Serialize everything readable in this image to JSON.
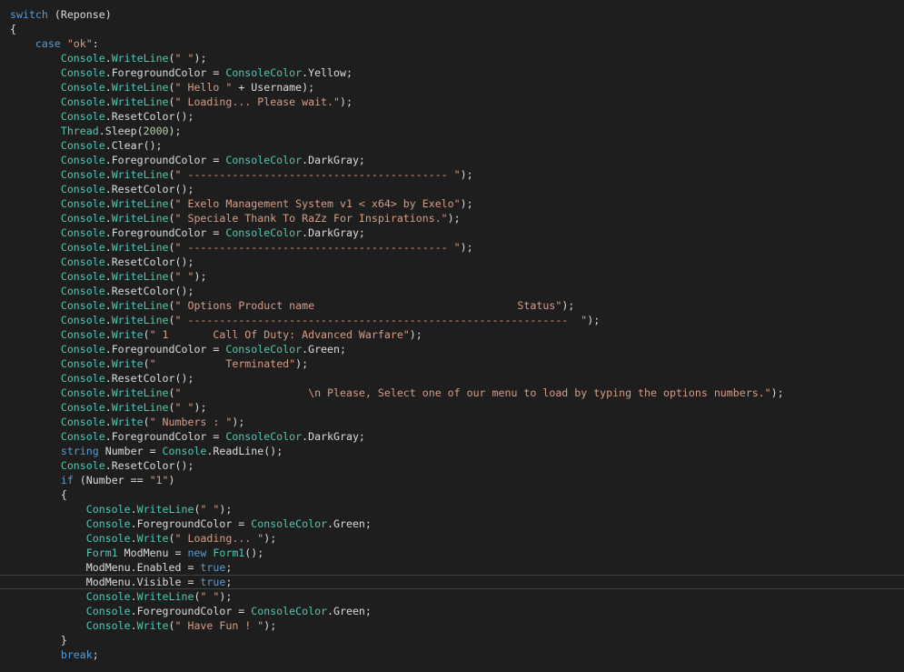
{
  "editor": {
    "language": "C#",
    "current_line_index": 39,
    "colors": {
      "background": "#1e1e1e",
      "plain": "#dcdcdc",
      "keyword": "#569cd6",
      "type": "#4ec9b0",
      "string": "#d69d85",
      "number": "#b5cea8"
    }
  },
  "lines": [
    [
      [
        "kw",
        "switch"
      ],
      [
        "pl",
        " (Reponse)"
      ]
    ],
    [
      [
        "pl",
        "{"
      ]
    ],
    [
      [
        "pl",
        "    "
      ],
      [
        "kw",
        "case"
      ],
      [
        "pl",
        " "
      ],
      [
        "str",
        "\"ok\""
      ],
      [
        "pl",
        ":"
      ]
    ],
    [
      [
        "pl",
        "        "
      ],
      [
        "ty",
        "Console"
      ],
      [
        "pl",
        "."
      ],
      [
        "ty",
        "WriteLine"
      ],
      [
        "pl",
        "("
      ],
      [
        "str",
        "\" \""
      ],
      [
        "pl",
        ");"
      ]
    ],
    [
      [
        "pl",
        "        "
      ],
      [
        "ty",
        "Console"
      ],
      [
        "pl",
        ".ForegroundColor = "
      ],
      [
        "ty",
        "ConsoleColor"
      ],
      [
        "pl",
        ".Yellow;"
      ]
    ],
    [
      [
        "pl",
        "        "
      ],
      [
        "ty",
        "Console"
      ],
      [
        "pl",
        "."
      ],
      [
        "ty",
        "WriteLine"
      ],
      [
        "pl",
        "("
      ],
      [
        "str",
        "\" Hello \""
      ],
      [
        "pl",
        " + Username);"
      ]
    ],
    [
      [
        "pl",
        "        "
      ],
      [
        "ty",
        "Console"
      ],
      [
        "pl",
        "."
      ],
      [
        "ty",
        "WriteLine"
      ],
      [
        "pl",
        "("
      ],
      [
        "str",
        "\" Loading... Please wait.\""
      ],
      [
        "pl",
        ");"
      ]
    ],
    [
      [
        "pl",
        "        "
      ],
      [
        "ty",
        "Console"
      ],
      [
        "pl",
        ".ResetColor();"
      ]
    ],
    [
      [
        "pl",
        "        "
      ],
      [
        "ty",
        "Thread"
      ],
      [
        "pl",
        ".Sleep("
      ],
      [
        "num",
        "2000"
      ],
      [
        "pl",
        ");"
      ]
    ],
    [
      [
        "pl",
        "        "
      ],
      [
        "ty",
        "Console"
      ],
      [
        "pl",
        ".Clear();"
      ]
    ],
    [
      [
        "pl",
        "        "
      ],
      [
        "ty",
        "Console"
      ],
      [
        "pl",
        ".ForegroundColor = "
      ],
      [
        "ty",
        "ConsoleColor"
      ],
      [
        "pl",
        ".DarkGray;"
      ]
    ],
    [
      [
        "pl",
        "        "
      ],
      [
        "ty",
        "Console"
      ],
      [
        "pl",
        "."
      ],
      [
        "ty",
        "WriteLine"
      ],
      [
        "pl",
        "("
      ],
      [
        "str",
        "\" ----------------------------------------- \""
      ],
      [
        "pl",
        ");"
      ]
    ],
    [
      [
        "pl",
        "        "
      ],
      [
        "ty",
        "Console"
      ],
      [
        "pl",
        ".ResetColor();"
      ]
    ],
    [
      [
        "pl",
        "        "
      ],
      [
        "ty",
        "Console"
      ],
      [
        "pl",
        "."
      ],
      [
        "ty",
        "WriteLine"
      ],
      [
        "pl",
        "("
      ],
      [
        "str",
        "\" Exelo Management System v1 < x64> by Exelo\""
      ],
      [
        "pl",
        ");"
      ]
    ],
    [
      [
        "pl",
        "        "
      ],
      [
        "ty",
        "Console"
      ],
      [
        "pl",
        "."
      ],
      [
        "ty",
        "WriteLine"
      ],
      [
        "pl",
        "("
      ],
      [
        "str",
        "\" Speciale Thank To RaZz For Inspirations.\""
      ],
      [
        "pl",
        ");"
      ]
    ],
    [
      [
        "pl",
        "        "
      ],
      [
        "ty",
        "Console"
      ],
      [
        "pl",
        ".ForegroundColor = "
      ],
      [
        "ty",
        "ConsoleColor"
      ],
      [
        "pl",
        ".DarkGray;"
      ]
    ],
    [
      [
        "pl",
        "        "
      ],
      [
        "ty",
        "Console"
      ],
      [
        "pl",
        "."
      ],
      [
        "ty",
        "WriteLine"
      ],
      [
        "pl",
        "("
      ],
      [
        "str",
        "\" ----------------------------------------- \""
      ],
      [
        "pl",
        ");"
      ]
    ],
    [
      [
        "pl",
        "        "
      ],
      [
        "ty",
        "Console"
      ],
      [
        "pl",
        ".ResetColor();"
      ]
    ],
    [
      [
        "pl",
        "        "
      ],
      [
        "ty",
        "Console"
      ],
      [
        "pl",
        "."
      ],
      [
        "ty",
        "WriteLine"
      ],
      [
        "pl",
        "("
      ],
      [
        "str",
        "\" \""
      ],
      [
        "pl",
        ");"
      ]
    ],
    [
      [
        "pl",
        "        "
      ],
      [
        "ty",
        "Console"
      ],
      [
        "pl",
        ".ResetColor();"
      ]
    ],
    [
      [
        "pl",
        "        "
      ],
      [
        "ty",
        "Console"
      ],
      [
        "pl",
        "."
      ],
      [
        "ty",
        "WriteLine"
      ],
      [
        "pl",
        "("
      ],
      [
        "str",
        "\" Options Product name                                Status\""
      ],
      [
        "pl",
        ");"
      ]
    ],
    [
      [
        "pl",
        "        "
      ],
      [
        "ty",
        "Console"
      ],
      [
        "pl",
        "."
      ],
      [
        "ty",
        "WriteLine"
      ],
      [
        "pl",
        "("
      ],
      [
        "str",
        "\" ------------------------------------------------------------  \""
      ],
      [
        "pl",
        ");"
      ]
    ],
    [
      [
        "pl",
        "        "
      ],
      [
        "ty",
        "Console"
      ],
      [
        "pl",
        "."
      ],
      [
        "ty",
        "Write"
      ],
      [
        "pl",
        "("
      ],
      [
        "str",
        "\" 1       Call Of Duty: Advanced Warfare\""
      ],
      [
        "pl",
        ");"
      ]
    ],
    [
      [
        "pl",
        "        "
      ],
      [
        "ty",
        "Console"
      ],
      [
        "pl",
        ".ForegroundColor = "
      ],
      [
        "ty",
        "ConsoleColor"
      ],
      [
        "pl",
        ".Green;"
      ]
    ],
    [
      [
        "pl",
        "        "
      ],
      [
        "ty",
        "Console"
      ],
      [
        "pl",
        "."
      ],
      [
        "ty",
        "Write"
      ],
      [
        "pl",
        "("
      ],
      [
        "str",
        "\"           Terminated\""
      ],
      [
        "pl",
        ");"
      ]
    ],
    [
      [
        "pl",
        "        "
      ],
      [
        "ty",
        "Console"
      ],
      [
        "pl",
        ".ResetColor();"
      ]
    ],
    [
      [
        "pl",
        "        "
      ],
      [
        "ty",
        "Console"
      ],
      [
        "pl",
        "."
      ],
      [
        "ty",
        "WriteLine"
      ],
      [
        "pl",
        "("
      ],
      [
        "str",
        "\"                    \\n Please, Select one of our menu to load by typing the options numbers.\""
      ],
      [
        "pl",
        ");"
      ]
    ],
    [
      [
        "pl",
        "        "
      ],
      [
        "ty",
        "Console"
      ],
      [
        "pl",
        "."
      ],
      [
        "ty",
        "WriteLine"
      ],
      [
        "pl",
        "("
      ],
      [
        "str",
        "\" \""
      ],
      [
        "pl",
        ");"
      ]
    ],
    [
      [
        "pl",
        "        "
      ],
      [
        "ty",
        "Console"
      ],
      [
        "pl",
        "."
      ],
      [
        "ty",
        "Write"
      ],
      [
        "pl",
        "("
      ],
      [
        "str",
        "\" Numbers : \""
      ],
      [
        "pl",
        ");"
      ]
    ],
    [
      [
        "pl",
        "        "
      ],
      [
        "ty",
        "Console"
      ],
      [
        "pl",
        ".ForegroundColor = "
      ],
      [
        "ty",
        "ConsoleColor"
      ],
      [
        "pl",
        ".DarkGray;"
      ]
    ],
    [
      [
        "pl",
        "        "
      ],
      [
        "kw",
        "string"
      ],
      [
        "pl",
        " Number = "
      ],
      [
        "ty",
        "Console"
      ],
      [
        "pl",
        ".ReadLine();"
      ]
    ],
    [
      [
        "pl",
        "        "
      ],
      [
        "ty",
        "Console"
      ],
      [
        "pl",
        ".ResetColor();"
      ]
    ],
    [
      [
        "pl",
        "        "
      ],
      [
        "kw",
        "if"
      ],
      [
        "pl",
        " (Number == "
      ],
      [
        "str",
        "\"1\""
      ],
      [
        "pl",
        ")"
      ]
    ],
    [
      [
        "pl",
        "        {"
      ]
    ],
    [
      [
        "pl",
        "            "
      ],
      [
        "ty",
        "Console"
      ],
      [
        "pl",
        "."
      ],
      [
        "ty",
        "WriteLine"
      ],
      [
        "pl",
        "("
      ],
      [
        "str",
        "\" \""
      ],
      [
        "pl",
        ");"
      ]
    ],
    [
      [
        "pl",
        "            "
      ],
      [
        "ty",
        "Console"
      ],
      [
        "pl",
        ".ForegroundColor = "
      ],
      [
        "ty",
        "ConsoleColor"
      ],
      [
        "pl",
        ".Green;"
      ]
    ],
    [
      [
        "pl",
        "            "
      ],
      [
        "ty",
        "Console"
      ],
      [
        "pl",
        "."
      ],
      [
        "ty",
        "Write"
      ],
      [
        "pl",
        "("
      ],
      [
        "str",
        "\" Loading... \""
      ],
      [
        "pl",
        ");"
      ]
    ],
    [
      [
        "pl",
        "            "
      ],
      [
        "ty",
        "Form1"
      ],
      [
        "pl",
        " ModMenu = "
      ],
      [
        "kw",
        "new"
      ],
      [
        "pl",
        " "
      ],
      [
        "ty",
        "Form1"
      ],
      [
        "pl",
        "();"
      ]
    ],
    [
      [
        "pl",
        "            ModMenu.Enabled = "
      ],
      [
        "kw",
        "true"
      ],
      [
        "pl",
        ";"
      ]
    ],
    [
      [
        "pl",
        "            ModMenu.Visible = "
      ],
      [
        "kw",
        "true"
      ],
      [
        "pl",
        ";"
      ]
    ],
    [
      [
        "pl",
        "            "
      ],
      [
        "ty",
        "Console"
      ],
      [
        "pl",
        "."
      ],
      [
        "ty",
        "WriteLine"
      ],
      [
        "pl",
        "("
      ],
      [
        "str",
        "\" \""
      ],
      [
        "pl",
        ");"
      ]
    ],
    [
      [
        "pl",
        "            "
      ],
      [
        "ty",
        "Console"
      ],
      [
        "pl",
        ".ForegroundColor = "
      ],
      [
        "ty",
        "ConsoleColor"
      ],
      [
        "pl",
        ".Green;"
      ]
    ],
    [
      [
        "pl",
        "            "
      ],
      [
        "ty",
        "Console"
      ],
      [
        "pl",
        "."
      ],
      [
        "ty",
        "Write"
      ],
      [
        "pl",
        "("
      ],
      [
        "str",
        "\" Have Fun ! \""
      ],
      [
        "pl",
        ");"
      ]
    ],
    [
      [
        "pl",
        "        }"
      ]
    ],
    [
      [
        "pl",
        "        "
      ],
      [
        "kw",
        "break"
      ],
      [
        "pl",
        ";"
      ]
    ]
  ]
}
